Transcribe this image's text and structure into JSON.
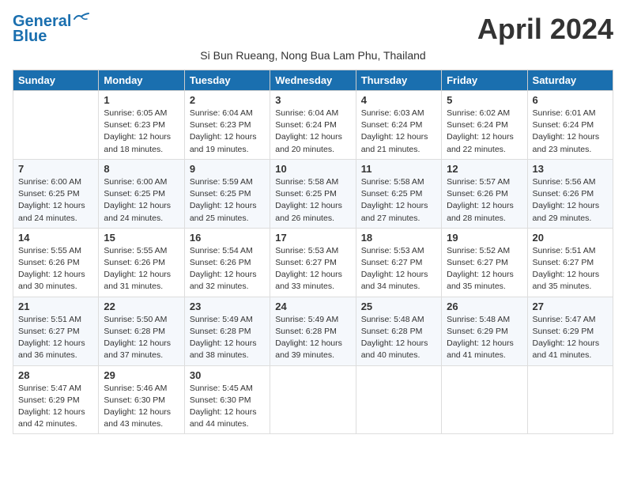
{
  "header": {
    "logo_general": "General",
    "logo_blue": "Blue",
    "month_title": "April 2024",
    "subtitle": "Si Bun Rueang, Nong Bua Lam Phu, Thailand"
  },
  "days_of_week": [
    "Sunday",
    "Monday",
    "Tuesday",
    "Wednesday",
    "Thursday",
    "Friday",
    "Saturday"
  ],
  "weeks": [
    [
      {
        "day": "",
        "sunrise": "",
        "sunset": "",
        "daylight": ""
      },
      {
        "day": "1",
        "sunrise": "Sunrise: 6:05 AM",
        "sunset": "Sunset: 6:23 PM",
        "daylight": "Daylight: 12 hours and 18 minutes."
      },
      {
        "day": "2",
        "sunrise": "Sunrise: 6:04 AM",
        "sunset": "Sunset: 6:23 PM",
        "daylight": "Daylight: 12 hours and 19 minutes."
      },
      {
        "day": "3",
        "sunrise": "Sunrise: 6:04 AM",
        "sunset": "Sunset: 6:24 PM",
        "daylight": "Daylight: 12 hours and 20 minutes."
      },
      {
        "day": "4",
        "sunrise": "Sunrise: 6:03 AM",
        "sunset": "Sunset: 6:24 PM",
        "daylight": "Daylight: 12 hours and 21 minutes."
      },
      {
        "day": "5",
        "sunrise": "Sunrise: 6:02 AM",
        "sunset": "Sunset: 6:24 PM",
        "daylight": "Daylight: 12 hours and 22 minutes."
      },
      {
        "day": "6",
        "sunrise": "Sunrise: 6:01 AM",
        "sunset": "Sunset: 6:24 PM",
        "daylight": "Daylight: 12 hours and 23 minutes."
      }
    ],
    [
      {
        "day": "7",
        "sunrise": "Sunrise: 6:00 AM",
        "sunset": "Sunset: 6:25 PM",
        "daylight": "Daylight: 12 hours and 24 minutes."
      },
      {
        "day": "8",
        "sunrise": "Sunrise: 6:00 AM",
        "sunset": "Sunset: 6:25 PM",
        "daylight": "Daylight: 12 hours and 24 minutes."
      },
      {
        "day": "9",
        "sunrise": "Sunrise: 5:59 AM",
        "sunset": "Sunset: 6:25 PM",
        "daylight": "Daylight: 12 hours and 25 minutes."
      },
      {
        "day": "10",
        "sunrise": "Sunrise: 5:58 AM",
        "sunset": "Sunset: 6:25 PM",
        "daylight": "Daylight: 12 hours and 26 minutes."
      },
      {
        "day": "11",
        "sunrise": "Sunrise: 5:58 AM",
        "sunset": "Sunset: 6:25 PM",
        "daylight": "Daylight: 12 hours and 27 minutes."
      },
      {
        "day": "12",
        "sunrise": "Sunrise: 5:57 AM",
        "sunset": "Sunset: 6:26 PM",
        "daylight": "Daylight: 12 hours and 28 minutes."
      },
      {
        "day": "13",
        "sunrise": "Sunrise: 5:56 AM",
        "sunset": "Sunset: 6:26 PM",
        "daylight": "Daylight: 12 hours and 29 minutes."
      }
    ],
    [
      {
        "day": "14",
        "sunrise": "Sunrise: 5:55 AM",
        "sunset": "Sunset: 6:26 PM",
        "daylight": "Daylight: 12 hours and 30 minutes."
      },
      {
        "day": "15",
        "sunrise": "Sunrise: 5:55 AM",
        "sunset": "Sunset: 6:26 PM",
        "daylight": "Daylight: 12 hours and 31 minutes."
      },
      {
        "day": "16",
        "sunrise": "Sunrise: 5:54 AM",
        "sunset": "Sunset: 6:26 PM",
        "daylight": "Daylight: 12 hours and 32 minutes."
      },
      {
        "day": "17",
        "sunrise": "Sunrise: 5:53 AM",
        "sunset": "Sunset: 6:27 PM",
        "daylight": "Daylight: 12 hours and 33 minutes."
      },
      {
        "day": "18",
        "sunrise": "Sunrise: 5:53 AM",
        "sunset": "Sunset: 6:27 PM",
        "daylight": "Daylight: 12 hours and 34 minutes."
      },
      {
        "day": "19",
        "sunrise": "Sunrise: 5:52 AM",
        "sunset": "Sunset: 6:27 PM",
        "daylight": "Daylight: 12 hours and 35 minutes."
      },
      {
        "day": "20",
        "sunrise": "Sunrise: 5:51 AM",
        "sunset": "Sunset: 6:27 PM",
        "daylight": "Daylight: 12 hours and 35 minutes."
      }
    ],
    [
      {
        "day": "21",
        "sunrise": "Sunrise: 5:51 AM",
        "sunset": "Sunset: 6:27 PM",
        "daylight": "Daylight: 12 hours and 36 minutes."
      },
      {
        "day": "22",
        "sunrise": "Sunrise: 5:50 AM",
        "sunset": "Sunset: 6:28 PM",
        "daylight": "Daylight: 12 hours and 37 minutes."
      },
      {
        "day": "23",
        "sunrise": "Sunrise: 5:49 AM",
        "sunset": "Sunset: 6:28 PM",
        "daylight": "Daylight: 12 hours and 38 minutes."
      },
      {
        "day": "24",
        "sunrise": "Sunrise: 5:49 AM",
        "sunset": "Sunset: 6:28 PM",
        "daylight": "Daylight: 12 hours and 39 minutes."
      },
      {
        "day": "25",
        "sunrise": "Sunrise: 5:48 AM",
        "sunset": "Sunset: 6:28 PM",
        "daylight": "Daylight: 12 hours and 40 minutes."
      },
      {
        "day": "26",
        "sunrise": "Sunrise: 5:48 AM",
        "sunset": "Sunset: 6:29 PM",
        "daylight": "Daylight: 12 hours and 41 minutes."
      },
      {
        "day": "27",
        "sunrise": "Sunrise: 5:47 AM",
        "sunset": "Sunset: 6:29 PM",
        "daylight": "Daylight: 12 hours and 41 minutes."
      }
    ],
    [
      {
        "day": "28",
        "sunrise": "Sunrise: 5:47 AM",
        "sunset": "Sunset: 6:29 PM",
        "daylight": "Daylight: 12 hours and 42 minutes."
      },
      {
        "day": "29",
        "sunrise": "Sunrise: 5:46 AM",
        "sunset": "Sunset: 6:30 PM",
        "daylight": "Daylight: 12 hours and 43 minutes."
      },
      {
        "day": "30",
        "sunrise": "Sunrise: 5:45 AM",
        "sunset": "Sunset: 6:30 PM",
        "daylight": "Daylight: 12 hours and 44 minutes."
      },
      {
        "day": "",
        "sunrise": "",
        "sunset": "",
        "daylight": ""
      },
      {
        "day": "",
        "sunrise": "",
        "sunset": "",
        "daylight": ""
      },
      {
        "day": "",
        "sunrise": "",
        "sunset": "",
        "daylight": ""
      },
      {
        "day": "",
        "sunrise": "",
        "sunset": "",
        "daylight": ""
      }
    ]
  ]
}
